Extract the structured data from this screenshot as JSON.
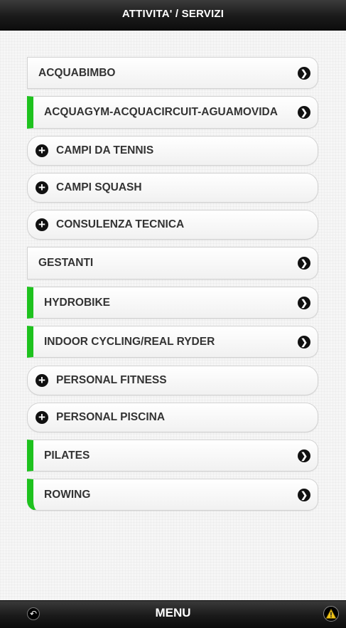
{
  "header": {
    "title": "ATTIVITA' / SERVIZI"
  },
  "items": [
    {
      "label": "ACQUABIMBO",
      "style": "plain",
      "icon": "chevron-right-icon"
    },
    {
      "label": "ACQUAGYM-ACQUACIRCUIT-AGUAMOVIDA",
      "style": "green",
      "icon": "chevron-right-icon"
    },
    {
      "label": "CAMPI DA TENNIS",
      "style": "expand",
      "icon": "plus-icon"
    },
    {
      "label": "CAMPI SQUASH",
      "style": "expand",
      "icon": "plus-icon"
    },
    {
      "label": "CONSULENZA TECNICA",
      "style": "expand",
      "icon": "plus-icon"
    },
    {
      "label": "GESTANTI",
      "style": "plain",
      "icon": "chevron-right-icon"
    },
    {
      "label": "HYDROBIKE",
      "style": "green",
      "icon": "chevron-right-icon"
    },
    {
      "label": "INDOOR CYCLING/REAL RYDER",
      "style": "green",
      "icon": "chevron-right-icon"
    },
    {
      "label": "PERSONAL FITNESS",
      "style": "expand",
      "icon": "plus-icon"
    },
    {
      "label": "PERSONAL PISCINA",
      "style": "expand",
      "icon": "plus-icon"
    },
    {
      "label": "PILATES",
      "style": "green",
      "icon": "chevron-right-icon"
    },
    {
      "label": "ROWING",
      "style": "green",
      "icon": "chevron-right-icon"
    }
  ],
  "footer": {
    "menu_label": "MENU",
    "left_icon": "back-icon",
    "right_icon": "warning-icon"
  },
  "colors": {
    "accent_green": "#1ec21e",
    "bar_dark": "#1a1a1a",
    "warning_yellow": "#f0c419"
  }
}
